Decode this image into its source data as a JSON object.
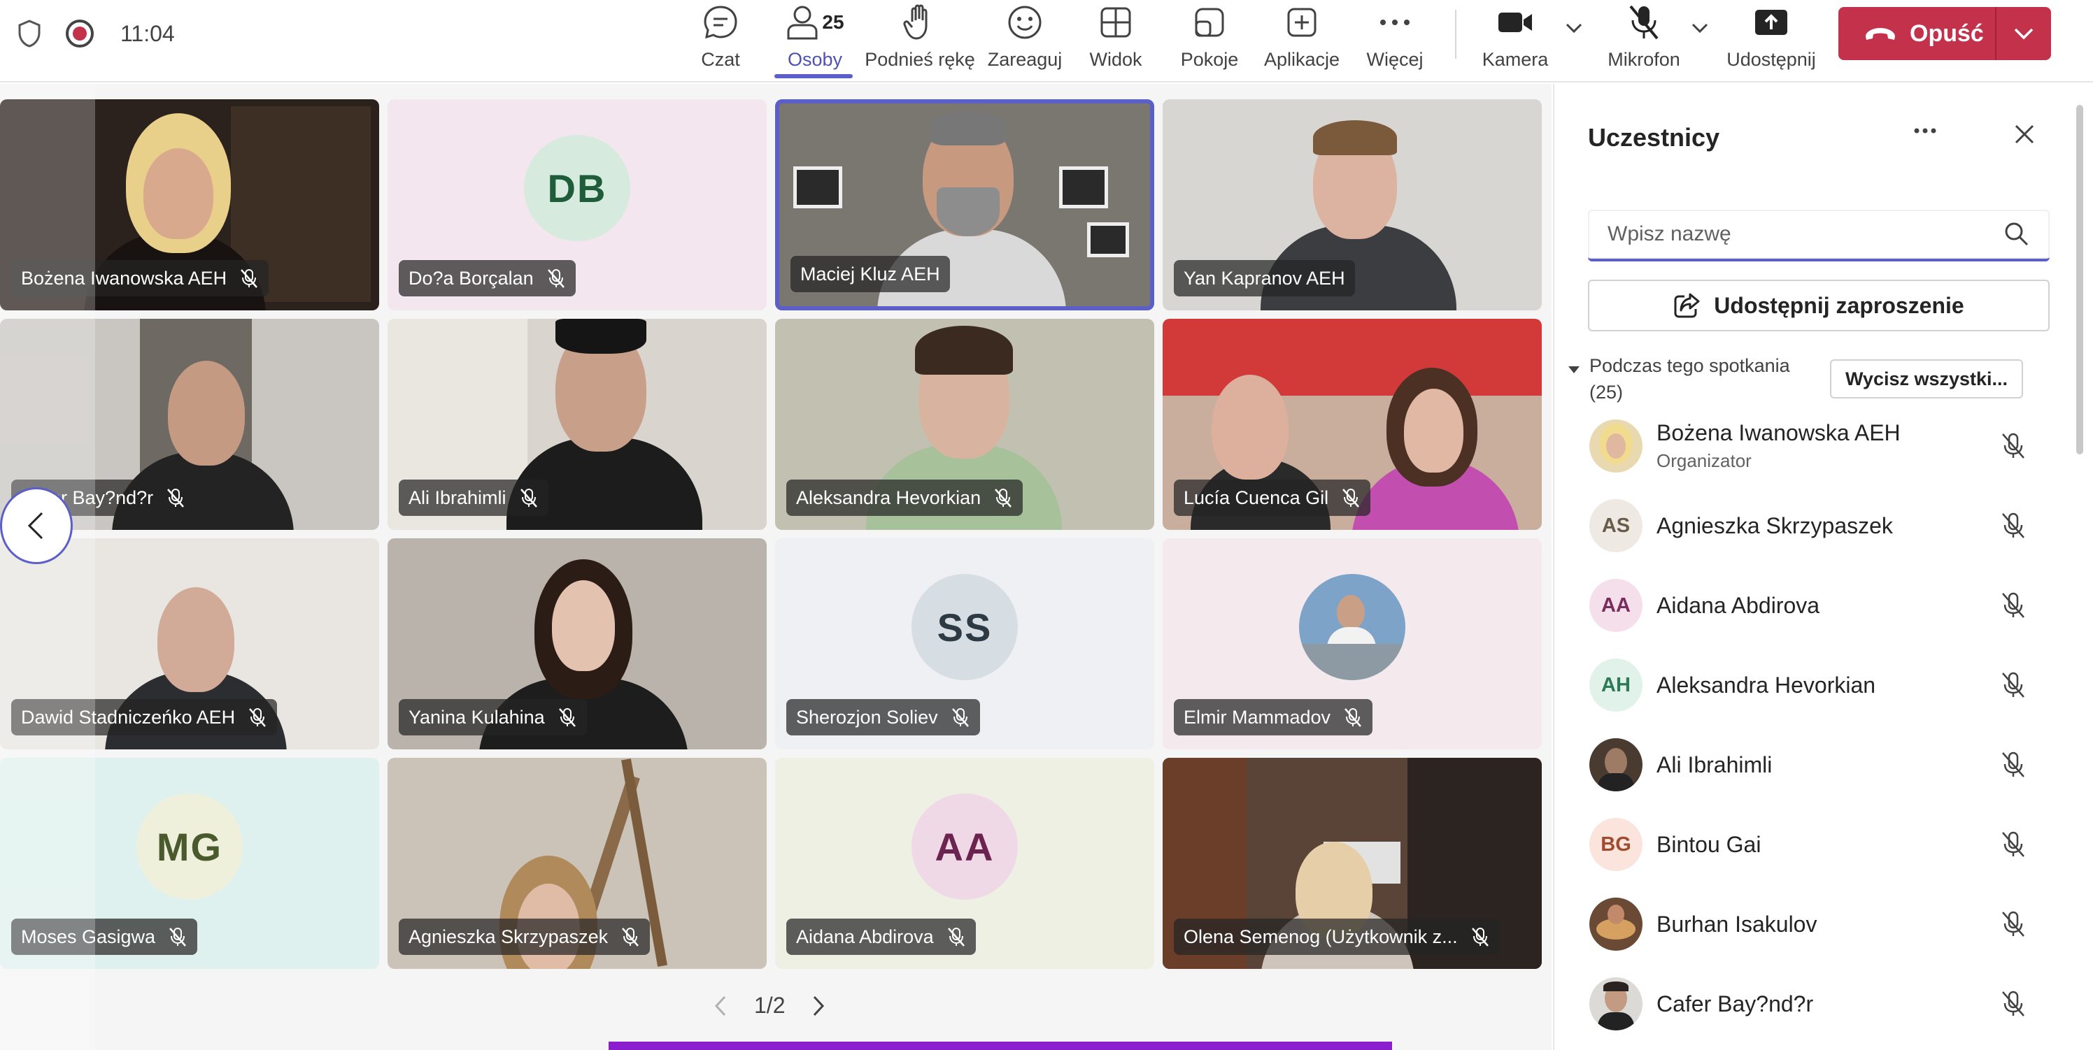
{
  "status": {
    "time": "11:04"
  },
  "toolbar": {
    "chat": "Czat",
    "people": "Osoby",
    "people_count": "25",
    "raise": "Podnieś rękę",
    "react": "Zareaguj",
    "view": "Widok",
    "rooms": "Pokoje",
    "apps": "Aplikacje",
    "more": "Więcej",
    "camera": "Kamera",
    "mic": "Mikrofon",
    "share": "Udostępnij",
    "leave": "Opuść"
  },
  "tiles": [
    {
      "name": "Bożena Iwanowska AEH"
    },
    {
      "name": "Do?a Borçalan",
      "initials": "DB"
    },
    {
      "name": "Maciej Kluz AEH"
    },
    {
      "name": "Yan Kapranov AEH"
    },
    {
      "name": "Cafer Bay?nd?r"
    },
    {
      "name": "Ali Ibrahimli"
    },
    {
      "name": "Aleksandra Hevorkian"
    },
    {
      "name": "Lucía Cuenca Gil"
    },
    {
      "name": "Dawid Stadniczeńko AEH"
    },
    {
      "name": "Yanina Kulahina"
    },
    {
      "name": "Sherozjon Soliev",
      "initials": "SS"
    },
    {
      "name": "Elmir Mammadov"
    },
    {
      "name": "Moses Gasigwa",
      "initials": "MG"
    },
    {
      "name": "Agnieszka Skrzypaszek"
    },
    {
      "name": "Aidana Abdirova",
      "initials": "AA"
    },
    {
      "name": "Olena Semenog (Użytkownik z..."
    }
  ],
  "pager": {
    "label": "1/2"
  },
  "panel": {
    "title": "Uczestnicy",
    "search_placeholder": "Wpisz nazwę",
    "share_invite": "Udostępnij zaproszenie",
    "section": "Podczas tego spotkania",
    "section_count": "(25)",
    "mute_all": "Wycisz wszystki...",
    "participants": [
      {
        "name": "Bożena Iwanowska AEH",
        "role": "Organizator",
        "initials": ""
      },
      {
        "name": "Agnieszka Skrzypaszek",
        "initials": "AS"
      },
      {
        "name": "Aidana Abdirova",
        "initials": "AA"
      },
      {
        "name": "Aleksandra Hevorkian",
        "initials": "AH"
      },
      {
        "name": "Ali Ibrahimli",
        "initials": ""
      },
      {
        "name": "Bintou Gai",
        "initials": "BG"
      },
      {
        "name": "Burhan Isakulov",
        "initials": ""
      },
      {
        "name": "Cafer Bay?nd?r",
        "initials": ""
      }
    ]
  },
  "colors": {
    "accent": "#5b5fc7",
    "leave": "#c4314b",
    "brand_bar": "#8b1fd0"
  }
}
